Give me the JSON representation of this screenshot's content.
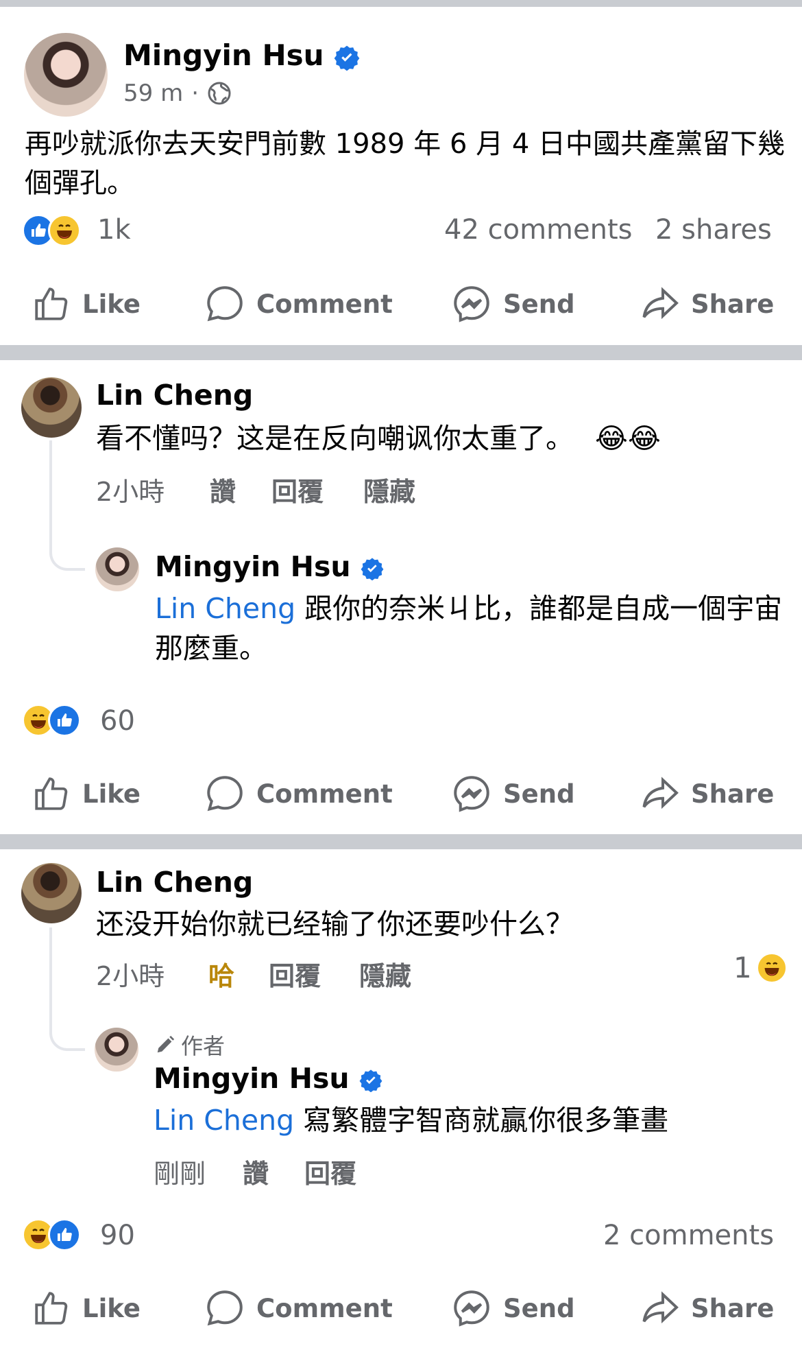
{
  "post": {
    "author": "Mingyin Hsu",
    "time": "59 m",
    "dot": "·",
    "text": "再吵就派你去天安門前數 1989 年 6 月 4 日中國共產黨留下幾個彈孔。",
    "reactions_count": "1k",
    "comments": "42 comments",
    "shares": "2 shares"
  },
  "actions": {
    "like": "Like",
    "comment": "Comment",
    "send": "Send",
    "share": "Share"
  },
  "card1": {
    "comment": {
      "author": "Lin Cheng",
      "text": "看不懂吗？这是在反向嘲讽你太重了。",
      "emoji": "😂😂",
      "time": "2小時",
      "like": "讚",
      "reply": "回覆",
      "hide": "隱藏"
    },
    "reply": {
      "author": "Mingyin Hsu",
      "mention": "Lin Cheng",
      "text": " 跟你的奈米ㄐ比，誰都是自成一個宇宙那麼重。"
    },
    "reactions_count": "60"
  },
  "card2": {
    "comment": {
      "author": "Lin Cheng",
      "text": "还没开始你就已经输了你还要吵什么？",
      "time": "2小時",
      "reaction_word": "哈",
      "reply": "回覆",
      "hide": "隱藏",
      "reaction_count": "1"
    },
    "reply": {
      "badge": "作者",
      "author": "Mingyin Hsu",
      "mention": "Lin Cheng",
      "text": " 寫繁體字智商就贏你很多筆畫",
      "time": "剛剛",
      "like": "讚",
      "reply": "回覆"
    },
    "reactions_count": "90",
    "comments": "2 comments"
  },
  "colors": {
    "link": "#1b6fd8",
    "verified": "#1b74e4",
    "muted": "#65676b",
    "separator": "#c9ccd1"
  }
}
